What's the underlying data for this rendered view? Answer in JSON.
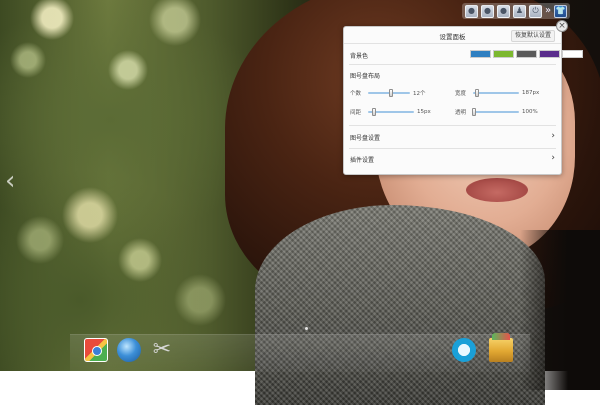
{
  "toolbar": {
    "buttons": [
      {
        "icon": "circle-icon",
        "glyph": "●"
      },
      {
        "icon": "circle-icon",
        "glyph": "●"
      },
      {
        "icon": "circle-icon",
        "glyph": "●"
      },
      {
        "icon": "person-icon",
        "glyph": "♟"
      },
      {
        "icon": "power-icon",
        "glyph": "⏻"
      },
      {
        "icon": "shirt-icon",
        "glyph": "👕"
      }
    ],
    "separator": "»"
  },
  "panel": {
    "title": "设置面板",
    "reset_label": "恢复默认设置",
    "close_glyph": "×",
    "background_label": "背景色",
    "background_colors": [
      "#2f7fc1",
      "#7cb82f",
      "#5a5a5a",
      "#5a2d8c",
      "#ffffff"
    ],
    "layout_section_label": "图号盘布局",
    "sliders": {
      "count": {
        "label": "个数",
        "value_text": "12个",
        "position": 0.55
      },
      "width": {
        "label": "宽度",
        "value_text": "187px",
        "position": 0.08
      },
      "spacing": {
        "label": "间距",
        "value_text": "15px",
        "position": 0.12
      },
      "opacity": {
        "label": "透明",
        "value_text": "100%",
        "position": 0.02
      }
    },
    "dial_settings_label": "图号盘设置",
    "plugin_settings_label": "插件设置",
    "chevron": "›"
  },
  "nav": {
    "left_arrow": "‹"
  },
  "dock": {
    "items": [
      {
        "name": "app-store",
        "icon": "app-store-icon"
      },
      {
        "name": "browser",
        "icon": "browser-icon"
      },
      {
        "name": "tools",
        "icon": "tools-icon",
        "glyph": "✂"
      },
      {
        "name": "clock",
        "icon": "clock-icon"
      },
      {
        "name": "box",
        "icon": "box-icon"
      }
    ]
  }
}
